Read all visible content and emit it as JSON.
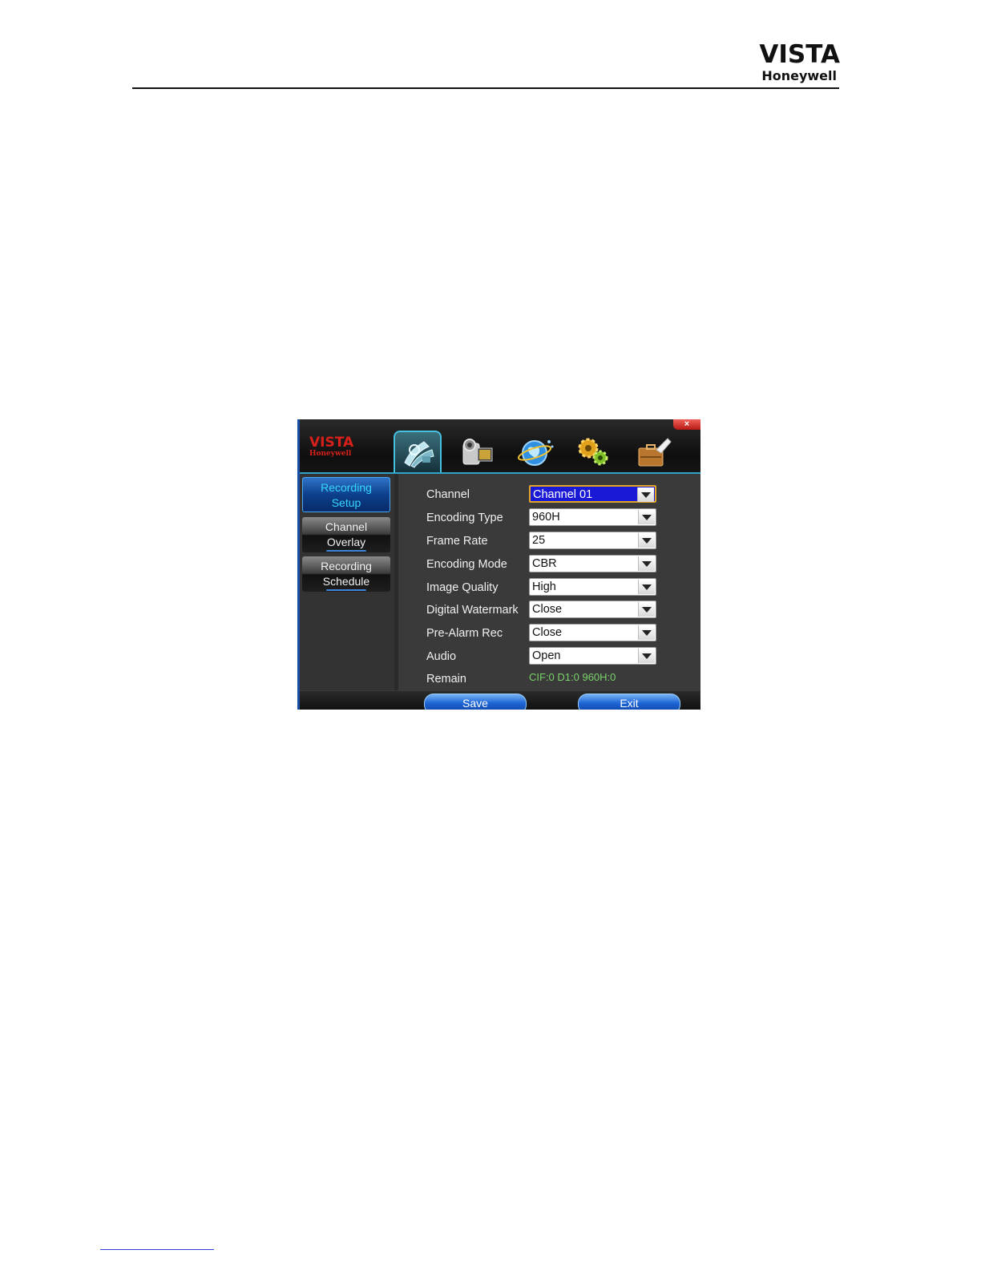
{
  "page_header": {
    "brand": "VISTA",
    "sub": "Honeywell"
  },
  "dvr": {
    "logo": {
      "brand": "VISTA",
      "sub": "Honeywell"
    },
    "close_label": "×",
    "tabs": [
      {
        "icon": "video-settings-icon",
        "active": true
      },
      {
        "icon": "camera-icon",
        "active": false
      },
      {
        "icon": "network-globe-icon",
        "active": false
      },
      {
        "icon": "gears-icon",
        "active": false
      },
      {
        "icon": "toolbox-icon",
        "active": false
      }
    ],
    "sidebar": [
      {
        "line1": "Recording",
        "line2": "Setup",
        "active": true
      },
      {
        "line1": "Channel",
        "line2": "Overlay",
        "active": false
      },
      {
        "line1": "Recording",
        "line2": "Schedule",
        "active": false
      }
    ],
    "fields": [
      {
        "label": "Channel",
        "value": "Channel 01"
      },
      {
        "label": "Encoding Type",
        "value": "960H"
      },
      {
        "label": "Frame Rate",
        "value": "25"
      },
      {
        "label": "Encoding Mode",
        "value": "CBR"
      },
      {
        "label": "Image Quality",
        "value": "High"
      },
      {
        "label": "Digital Watermark",
        "value": "Close"
      },
      {
        "label": "Pre-Alarm Rec",
        "value": "Close"
      },
      {
        "label": "Audio",
        "value": "Open"
      }
    ],
    "remain": {
      "label": "Remain",
      "value": "CIF:0 D1:0 960H:0"
    },
    "buttons": {
      "save": "Save",
      "exit": "Exit"
    },
    "colors": {
      "active_text": "#36d7ff",
      "remain_text": "#7bd26a",
      "focus_border": "#e3a52a",
      "close_button": "#d8201a"
    }
  }
}
